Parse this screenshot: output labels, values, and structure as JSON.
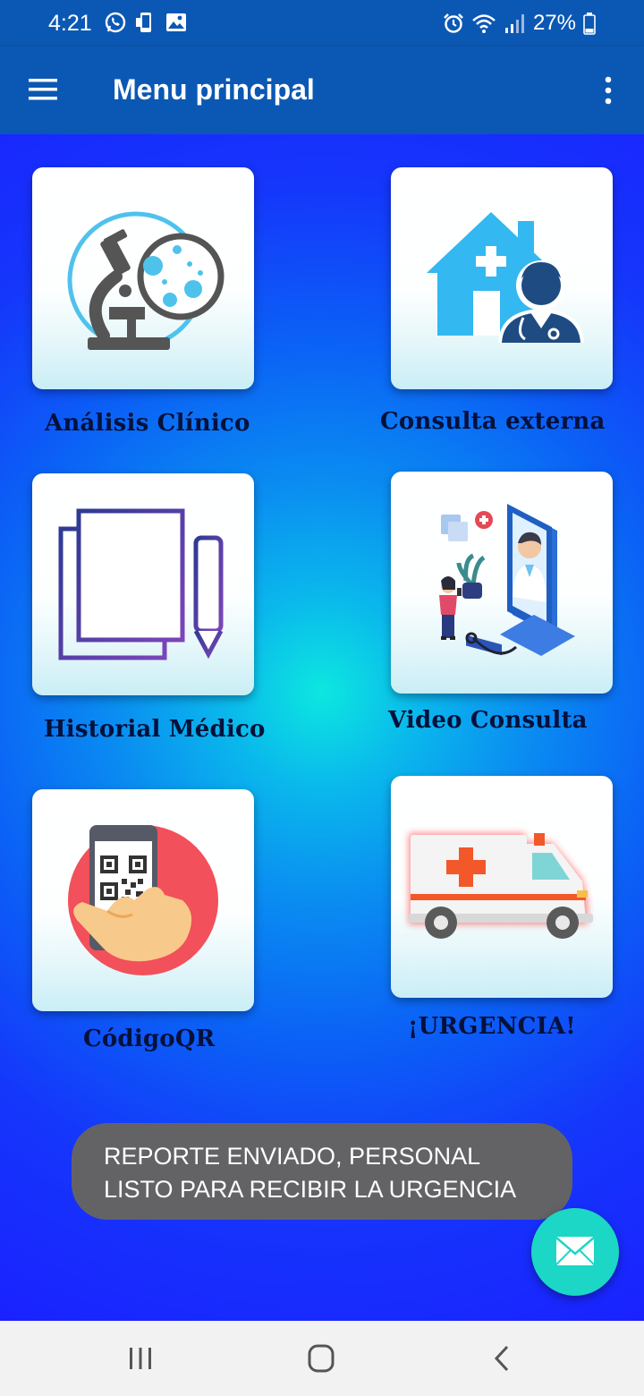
{
  "status_bar": {
    "time": "4:21",
    "battery": "27%"
  },
  "app_bar": {
    "title": "Menu principal"
  },
  "tiles": [
    {
      "label": "Análisis Clínico",
      "icon": "microscope-icon"
    },
    {
      "label": "Consulta externa",
      "icon": "house-doctor-icon"
    },
    {
      "label": "Historial Médico",
      "icon": "document-pencil-icon"
    },
    {
      "label": "Video Consulta",
      "icon": "video-call-doctor-icon"
    },
    {
      "label": "CódigoQR",
      "icon": "qr-phone-icon"
    },
    {
      "label": "¡URGENCIA!",
      "icon": "ambulance-icon"
    }
  ],
  "toast": {
    "message": "REPORTE ENVIADO, PERSONAL\nLISTO PARA RECIBIR LA URGENCIA"
  },
  "colors": {
    "app_bar": "#0b58b4",
    "fab": "#1cd6c6",
    "toast": "#636366",
    "label": "#04113a"
  }
}
